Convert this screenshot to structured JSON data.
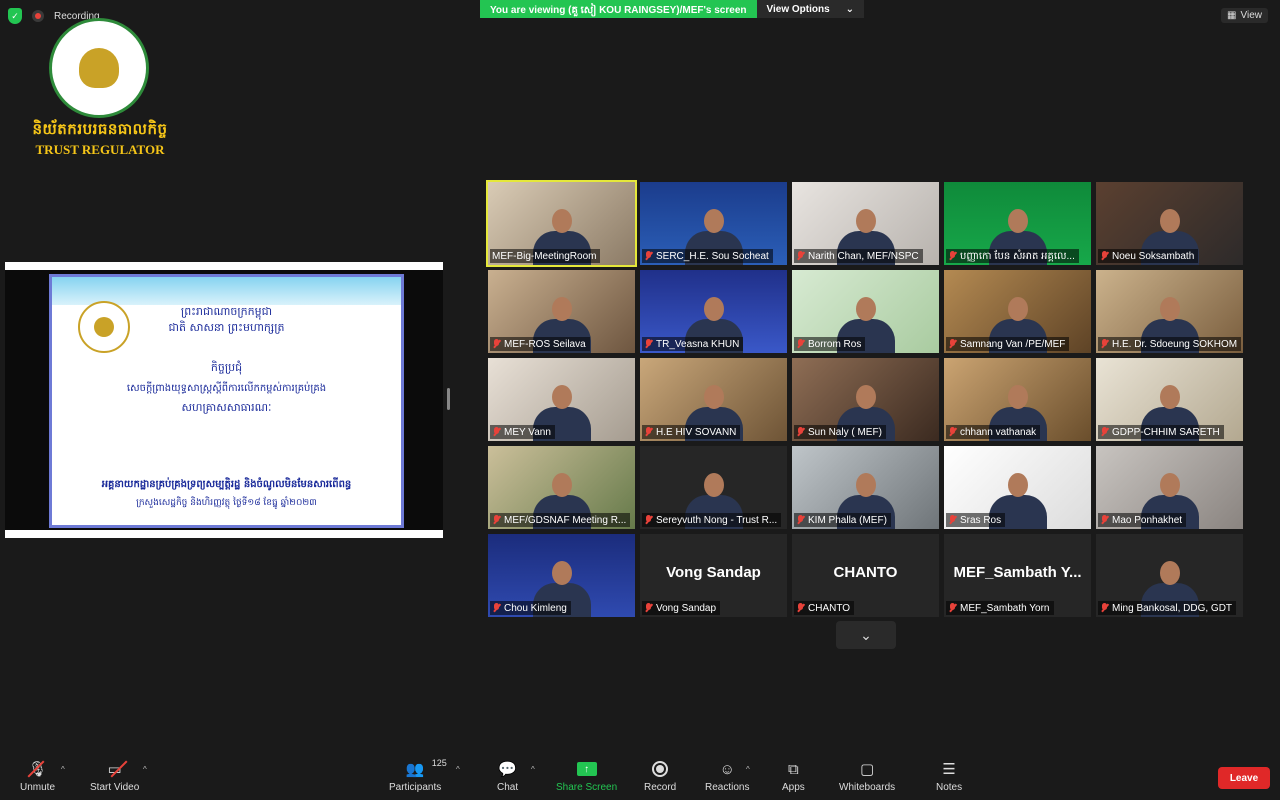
{
  "status": {
    "recording_label": "Recording"
  },
  "banner": {
    "viewing_text": "You are viewing (គួ សៀ KOU RAINGSEY)/MEF's screen",
    "view_options_label": "View Options"
  },
  "top_right": {
    "view_label": "View"
  },
  "logo": {
    "khmer_text": "និយ័តករបរធនធាលកិច្ច",
    "english_text": "TRUST REGULATOR"
  },
  "shared_slide": {
    "lines": [
      "ព្រះរាជាណាចក្រកម្ពុជា",
      "ជាតិ សាសនា ព្រះមហាក្សត្រ",
      "កិច្ចប្រជុំ",
      "សេចក្តីព្រាងយុទ្ធសាស្ត្រស្តីពីការលើកកម្ពស់ការគ្រប់គ្រង",
      "សហគ្រាសសាធារណៈ",
      "អគ្គនាយកដ្ឋានគ្រប់គ្រងទ្រព្យសម្បត្តិរដ្ឋ និងចំណូលមិនមែនសារពើពន្ធ",
      "ក្រសួងសេដ្ឋកិច្ច និងហិរញ្ញវត្ថុ ថ្ងៃទី១៨ ខែធ្នូ ឆ្នាំ២០២៣"
    ]
  },
  "participants": [
    {
      "name": "MEF-Big-MeetingRoom",
      "muted": false
    },
    {
      "name": "SERC_H.E. Sou Socheat",
      "muted": true
    },
    {
      "name": "Narith Chan, MEF/NSPC",
      "muted": true
    },
    {
      "name": "បញ្ញាកោ បែន សំអាត អគ្គលេ...",
      "muted": true
    },
    {
      "name": "Noeu Soksambath",
      "muted": true
    },
    {
      "name": "MEF-ROS Seilava",
      "muted": true
    },
    {
      "name": "TR_Veasna KHUN",
      "muted": true
    },
    {
      "name": "Borrom Ros",
      "muted": true
    },
    {
      "name": "Samnang Van /PE/MEF",
      "muted": true
    },
    {
      "name": "H.E. Dr. Sdoeung SOKHOM",
      "muted": true
    },
    {
      "name": "MEY Vann",
      "muted": true
    },
    {
      "name": "H.E  HIV  SOVANN",
      "muted": true
    },
    {
      "name": "Sun Naly ( MEF)",
      "muted": true
    },
    {
      "name": "chhann vathanak",
      "muted": true
    },
    {
      "name": "GDPP-CHHIM SARETH",
      "muted": true
    },
    {
      "name": "MEF/GDSNAF Meeting R...",
      "muted": true
    },
    {
      "name": "Sereyvuth Nong - Trust R...",
      "muted": true
    },
    {
      "name": "KIM Phalla (MEF)",
      "muted": true
    },
    {
      "name": "Sras Ros",
      "muted": true
    },
    {
      "name": "Mao Ponhakhet",
      "muted": true
    },
    {
      "name": "Chou Kimleng",
      "muted": true
    },
    {
      "name": "Vong Sandap",
      "muted": true,
      "display": "Vong Sandap"
    },
    {
      "name": "CHANTO",
      "muted": true,
      "display": "CHANTO"
    },
    {
      "name": "MEF_Sambath Yorn",
      "muted": true,
      "display": "MEF_Sambath Y..."
    },
    {
      "name": "Ming Bankosal, DDG, GDT",
      "muted": true
    }
  ],
  "toolbar": {
    "unmute": "Unmute",
    "start_video": "Start Video",
    "participants": "Participants",
    "participants_count": "125",
    "chat": "Chat",
    "share_screen": "Share Screen",
    "record": "Record",
    "reactions": "Reactions",
    "apps": "Apps",
    "whiteboards": "Whiteboards",
    "notes": "Notes",
    "leave": "Leave"
  },
  "colors": {
    "accent_green": "#23c552",
    "leave_red": "#e02828",
    "active_speaker": "#e5e83a",
    "muted_red": "#e8423a"
  }
}
